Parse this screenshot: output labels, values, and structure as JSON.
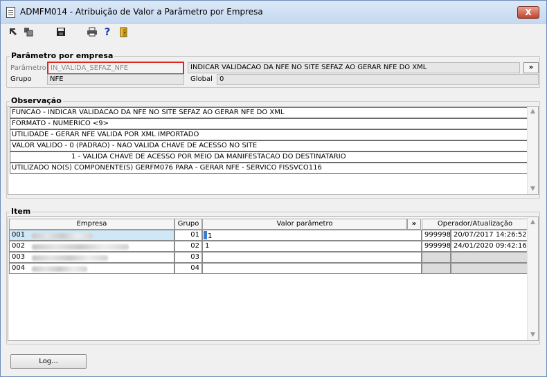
{
  "window": {
    "title": "ADMFM014 - Atribuição de Valor a Parâmetro por Empresa",
    "close_label": "X"
  },
  "toolbar": {
    "icons": [
      "arrow-select-icon",
      "copy-icon",
      "save-icon",
      "print-icon",
      "help-icon",
      "exit-icon"
    ],
    "help_glyph": "?"
  },
  "parametro_group": {
    "title": "Parâmetro por empresa",
    "parametro_label": "Parâmetro",
    "parametro_value": "IN_VALIDA_SEFAZ_NFE",
    "parametro_desc": "INDICAR VALIDACAO DA NFE NO SITE SEFAZ AO GERAR NFE DO XML",
    "expand_label": "»",
    "grupo_label": "Grupo",
    "grupo_value": "NFE",
    "global_label": "Global",
    "global_value": "0"
  },
  "observacao": {
    "title": "Observação",
    "lines": [
      "FUNCAO - INDICAR VALIDACAO DA NFE NO SITE SEFAZ AO GERAR NFE DO XML",
      "FORMATO - NUMERICO <9>",
      "UTILIDADE - GERAR NFE VALIDA POR XML IMPORTADO",
      "VALOR VALIDO - 0 (PADRAO) - NAO VALIDA CHAVE DE ACESSO NO SITE",
      "1 - VALIDA CHAVE DE ACESSO POR MEIO DA MANIFESTACAO DO DESTINATARIO",
      "UTILIZADO NO(S) COMPONENTE(S) GERFM076  PARA  - GERAR NFE - SERVICO FISSVCO116"
    ]
  },
  "item": {
    "title": "Item",
    "columns": {
      "empresa": "Empresa",
      "grupo": "Grupo",
      "valor": "Valor parâmetro",
      "expand": "»",
      "operador": "Operador/Atualização"
    },
    "rows": [
      {
        "codigo": "001",
        "grupo": "01",
        "valor": "1",
        "operador": "999998",
        "atualizacao": "20/07/2017 14:26:52"
      },
      {
        "codigo": "002",
        "grupo": "02",
        "valor": "1",
        "operador": "999998",
        "atualizacao": "24/01/2020 09:42:16"
      },
      {
        "codigo": "003",
        "grupo": "03",
        "valor": "",
        "operador": "",
        "atualizacao": ""
      },
      {
        "codigo": "004",
        "grupo": "04",
        "valor": "",
        "operador": "",
        "atualizacao": ""
      }
    ]
  },
  "footer": {
    "log_label": "Log..."
  }
}
